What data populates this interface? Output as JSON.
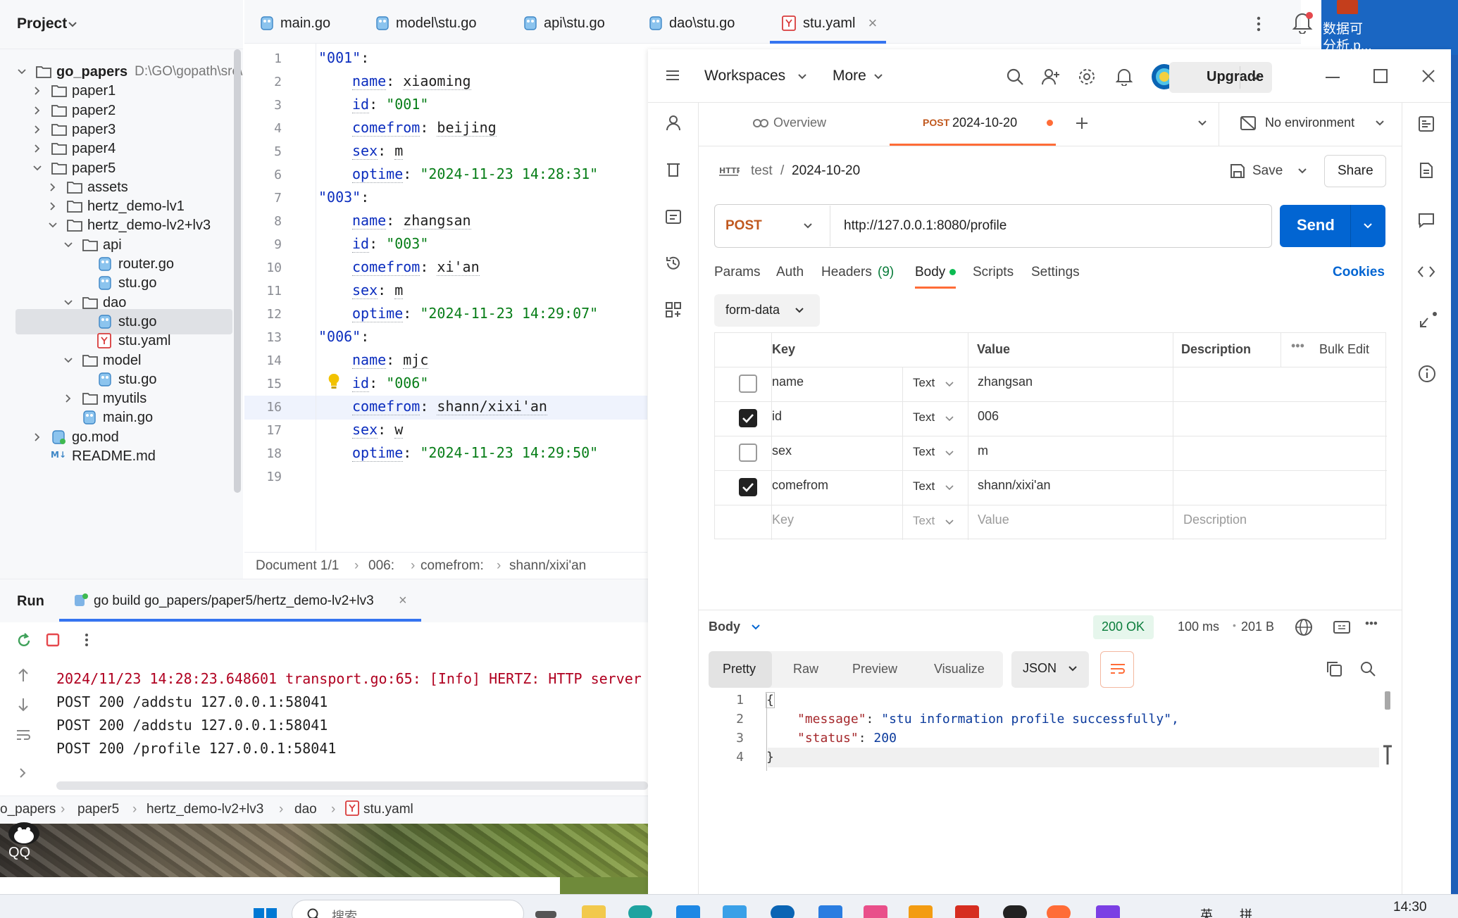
{
  "ide": {
    "project_label": "Project",
    "tree": [
      {
        "label": "go_papers",
        "extra": "D:\\GO\\gopath\\src\\",
        "depth": 0,
        "arrow": "down",
        "icon": "folder",
        "bold": true
      },
      {
        "label": "paper1",
        "depth": 1,
        "arrow": "right",
        "icon": "folder"
      },
      {
        "label": "paper2",
        "depth": 1,
        "arrow": "right",
        "icon": "folder"
      },
      {
        "label": "paper3",
        "depth": 1,
        "arrow": "right",
        "icon": "folder"
      },
      {
        "label": "paper4",
        "depth": 1,
        "arrow": "right",
        "icon": "folder"
      },
      {
        "label": "paper5",
        "depth": 1,
        "arrow": "down",
        "icon": "folder"
      },
      {
        "label": "assets",
        "depth": 2,
        "arrow": "right",
        "icon": "folder"
      },
      {
        "label": "hertz_demo-lv1",
        "depth": 2,
        "arrow": "right",
        "icon": "folder"
      },
      {
        "label": "hertz_demo-lv2+lv3",
        "depth": 2,
        "arrow": "down",
        "icon": "folder"
      },
      {
        "label": "api",
        "depth": 3,
        "arrow": "down",
        "icon": "folder"
      },
      {
        "label": "router.go",
        "depth": 4,
        "arrow": "none",
        "icon": "go"
      },
      {
        "label": "stu.go",
        "depth": 4,
        "arrow": "none",
        "icon": "go"
      },
      {
        "label": "dao",
        "depth": 3,
        "arrow": "down",
        "icon": "folder"
      },
      {
        "label": "stu.go",
        "depth": 4,
        "arrow": "none",
        "icon": "go",
        "selected": true
      },
      {
        "label": "stu.yaml",
        "depth": 4,
        "arrow": "none",
        "icon": "yaml"
      },
      {
        "label": "model",
        "depth": 3,
        "arrow": "down",
        "icon": "folder"
      },
      {
        "label": "stu.go",
        "depth": 4,
        "arrow": "none",
        "icon": "go"
      },
      {
        "label": "myutils",
        "depth": 3,
        "arrow": "right",
        "icon": "folder"
      },
      {
        "label": "main.go",
        "depth": 3,
        "arrow": "none",
        "icon": "go"
      },
      {
        "label": "go.mod",
        "depth": 1,
        "arrow": "right",
        "icon": "gomod"
      },
      {
        "label": "README.md",
        "depth": 1,
        "arrow": "none",
        "icon": "md"
      }
    ],
    "tabs": [
      {
        "label": "main.go",
        "icon": "go"
      },
      {
        "label": "model\\stu.go",
        "icon": "go"
      },
      {
        "label": "api\\stu.go",
        "icon": "go"
      },
      {
        "label": "dao\\stu.go",
        "icon": "go"
      },
      {
        "label": "stu.yaml",
        "icon": "yaml",
        "active": true
      }
    ],
    "code_lines": [
      {
        "n": "1",
        "indent": 0,
        "key": "\"001\"",
        "sep": ":",
        "val": "",
        "vtype": ""
      },
      {
        "n": "2",
        "indent": 1,
        "key": "name",
        "sep": ": ",
        "val": "xiaoming",
        "vtype": "plain"
      },
      {
        "n": "3",
        "indent": 1,
        "key": "id",
        "sep": ": ",
        "val": "\"001\"",
        "vtype": "str"
      },
      {
        "n": "4",
        "indent": 1,
        "key": "comefrom",
        "sep": ": ",
        "val": "beijing",
        "vtype": "plain"
      },
      {
        "n": "5",
        "indent": 1,
        "key": "sex",
        "sep": ": ",
        "val": "m",
        "vtype": "plain"
      },
      {
        "n": "6",
        "indent": 1,
        "key": "optime",
        "sep": ": ",
        "val": "\"2024-11-23 14:28:31\"",
        "vtype": "str"
      },
      {
        "n": "7",
        "indent": 0,
        "key": "\"003\"",
        "sep": ":",
        "val": "",
        "vtype": ""
      },
      {
        "n": "8",
        "indent": 1,
        "key": "name",
        "sep": ": ",
        "val": "zhangsan",
        "vtype": "plain"
      },
      {
        "n": "9",
        "indent": 1,
        "key": "id",
        "sep": ": ",
        "val": "\"003\"",
        "vtype": "str"
      },
      {
        "n": "10",
        "indent": 1,
        "key": "comefrom",
        "sep": ": ",
        "val": "xi'an",
        "vtype": "plain"
      },
      {
        "n": "11",
        "indent": 1,
        "key": "sex",
        "sep": ": ",
        "val": "m",
        "vtype": "plain"
      },
      {
        "n": "12",
        "indent": 1,
        "key": "optime",
        "sep": ": ",
        "val": "\"2024-11-23 14:29:07\"",
        "vtype": "str"
      },
      {
        "n": "13",
        "indent": 0,
        "key": "\"006\"",
        "sep": ":",
        "val": "",
        "vtype": ""
      },
      {
        "n": "14",
        "indent": 1,
        "key": "name",
        "sep": ": ",
        "val": "mjc",
        "vtype": "plain"
      },
      {
        "n": "15",
        "indent": 1,
        "key": "id",
        "sep": ": ",
        "val": "\"006\"",
        "vtype": "str"
      },
      {
        "n": "16",
        "indent": 1,
        "key": "comefrom",
        "sep": ": ",
        "val": "shann/xixi'an",
        "vtype": "plain"
      },
      {
        "n": "17",
        "indent": 1,
        "key": "sex",
        "sep": ": ",
        "val": "w",
        "vtype": "plain"
      },
      {
        "n": "18",
        "indent": 1,
        "key": "optime",
        "sep": ": ",
        "val": "\"2024-11-23 14:29:50\"",
        "vtype": "str"
      },
      {
        "n": "19",
        "indent": 0,
        "key": "",
        "sep": "",
        "val": "",
        "vtype": ""
      }
    ],
    "editor_breadcrumb": {
      "doc": "Document 1/1",
      "c1": "006:",
      "c2": "comefrom:",
      "c3": "shann/xixi'an"
    },
    "run": {
      "title": "Run",
      "config": "go build go_papers/paper5/hertz_demo-lv2+lv3",
      "log_error": "2024/11/23 14:28:23.648601 transport.go:65: [Info] HERTZ: HTTP server",
      "log_lines": [
        "POST 200 /addstu 127.0.0.1:58041",
        "POST 200 /addstu 127.0.0.1:58041",
        "POST 200 /profile 127.0.0.1:58041"
      ]
    },
    "status_path": {
      "p0": "o_papers",
      "p1": "paper5",
      "p2": "hertz_demo-lv2+lv3",
      "p3": "dao",
      "p4": "stu.yaml"
    }
  },
  "desktop": {
    "qq_label": "QQ",
    "top_right_line1": "数据可",
    "top_right_line2": "分析.p..."
  },
  "postman": {
    "workspaces": "Workspaces",
    "more": "More",
    "upgrade": "Upgrade",
    "tab_overview": "Overview",
    "tab_method": "POST",
    "tab_name": "2024-10-20",
    "environment": "No environment",
    "breadcrumb_collection": "test",
    "breadcrumb_sep": "/",
    "request_name": "2024-10-20",
    "save": "Save",
    "share": "Share",
    "method": "POST",
    "url": "http://127.0.0.1:8080/profile",
    "send": "Send",
    "req_tabs": {
      "params": "Params",
      "auth": "Auth",
      "headers": "Headers",
      "headers_count": "(9)",
      "body": "Body",
      "scripts": "Scripts",
      "settings": "Settings",
      "cookies": "Cookies"
    },
    "body_type": "form-data",
    "table_headers": {
      "key": "Key",
      "value": "Value",
      "description": "Description",
      "bulk_edit": "Bulk Edit"
    },
    "rows": [
      {
        "checked": false,
        "key": "name",
        "type": "Text",
        "value": "zhangsan",
        "description": ""
      },
      {
        "checked": true,
        "key": "id",
        "type": "Text",
        "value": "006",
        "description": ""
      },
      {
        "checked": false,
        "key": "sex",
        "type": "Text",
        "value": "m",
        "description": ""
      },
      {
        "checked": true,
        "key": "comefrom",
        "type": "Text",
        "value": "shann/xixi'an",
        "description": ""
      }
    ],
    "placeholder_row": {
      "key": "Key",
      "type": "Text",
      "value": "Value",
      "description": "Description"
    },
    "response": {
      "label": "Body",
      "status": "200 OK",
      "time": "100 ms",
      "size": "201 B",
      "formats": {
        "pretty": "Pretty",
        "raw": "Raw",
        "preview": "Preview",
        "visualize": "Visualize"
      },
      "lang": "JSON",
      "lines": [
        {
          "n": "1",
          "text": "{"
        },
        {
          "n": "2",
          "key": "\"message\"",
          "val": "\"stu information profile successfully\","
        },
        {
          "n": "3",
          "key": "\"status\"",
          "val": "200"
        },
        {
          "n": "4",
          "text": "}"
        }
      ]
    }
  },
  "taskbar": {
    "search_placeholder": "搜索",
    "time": "14:30",
    "tray1": "英",
    "tray2": "拼"
  },
  "colors": {
    "accent_blue": "#3574f0",
    "send_blue": "#0265d2",
    "postman_orange": "#ff6c37",
    "status_green": "#0cbb52",
    "yaml_key": "#0b2dbe",
    "yaml_string": "#067d17",
    "log_red": "#b00020"
  }
}
